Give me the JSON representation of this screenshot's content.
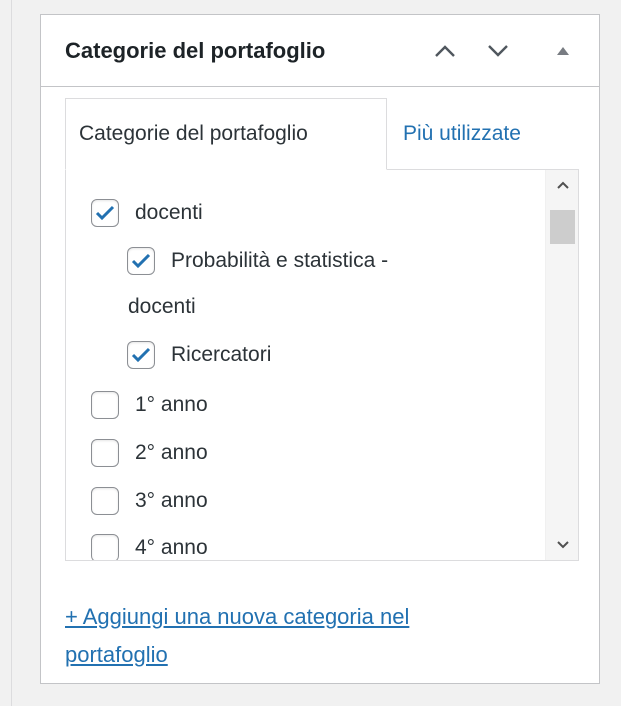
{
  "postbox": {
    "title": "Categorie del portafoglio"
  },
  "tabs": [
    {
      "label": "Categorie del portafoglio",
      "active": true
    },
    {
      "label": "Più utilizzate",
      "active": false
    }
  ],
  "categories": [
    {
      "label": "docenti",
      "checked": true
    },
    {
      "label_line1": "Probabilità e statistica -",
      "label_line2": "docenti",
      "checked": true
    },
    {
      "label": "Ricercatori",
      "checked": true
    },
    {
      "label": "1° anno",
      "checked": false
    },
    {
      "label": "2° anno",
      "checked": false
    },
    {
      "label": "3° anno",
      "checked": false
    },
    {
      "label": "4° anno",
      "checked": false
    }
  ],
  "add_link": {
    "line1": "+ Aggiungi una nuova categoria nel",
    "line2": "portafoglio"
  },
  "colors": {
    "link": "#2271b1",
    "checkmark": "#2271b1",
    "border": "#c3c4c7"
  }
}
